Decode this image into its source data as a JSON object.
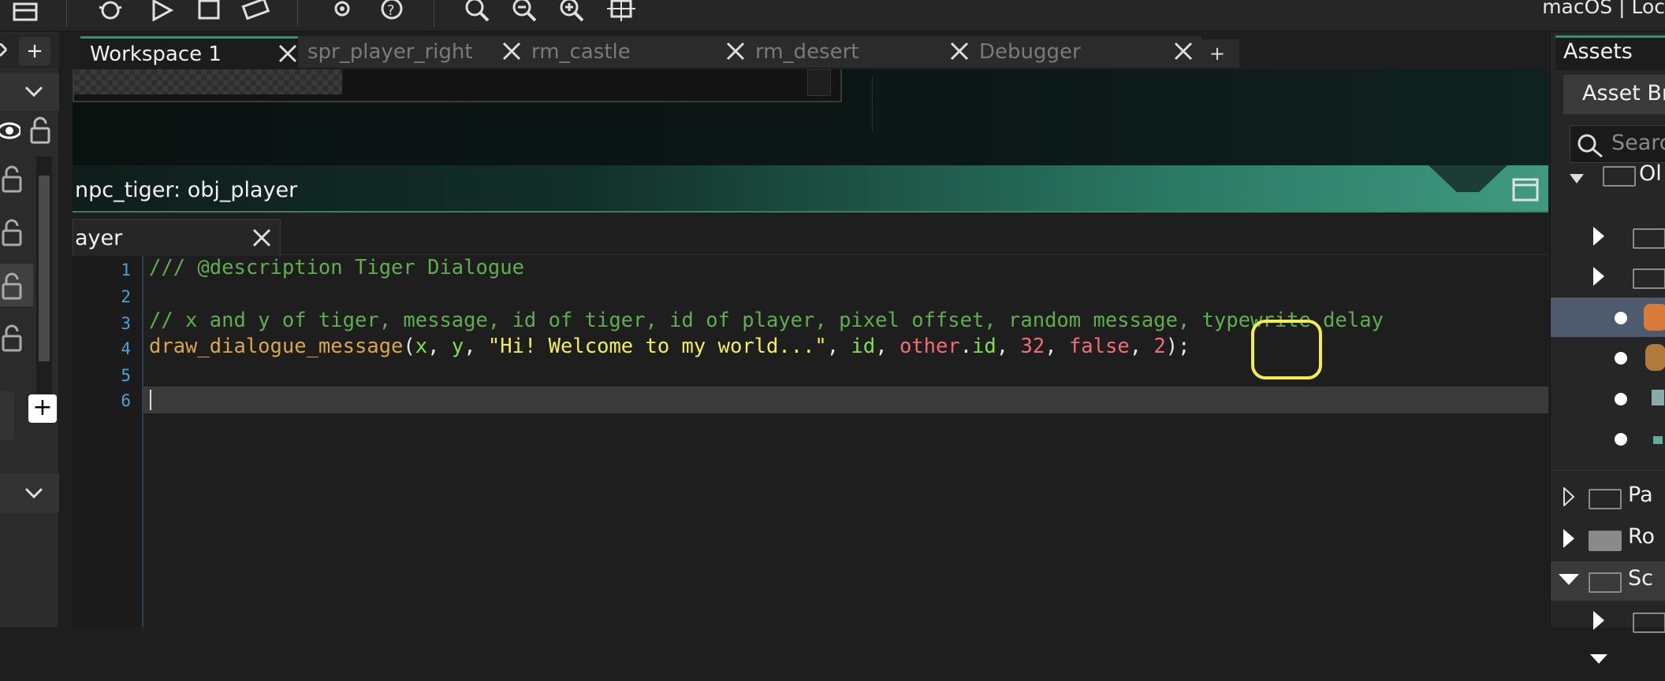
{
  "toolbar": {
    "os_label": "macOS | Loc"
  },
  "tabs": [
    {
      "label": "Workspace 1",
      "active": true
    },
    {
      "label": "spr_player_right",
      "active": false
    },
    {
      "label": "rm_castle",
      "active": false
    },
    {
      "label": "rm_desert",
      "active": false
    },
    {
      "label": "Debugger",
      "active": false
    }
  ],
  "tab_add_label": "+",
  "left_add_label": "+",
  "code_window": {
    "title": "npc_tiger: obj_player",
    "tab_label": "ayer"
  },
  "editor": {
    "line_numbers": [
      "1",
      "2",
      "3",
      "4",
      "5",
      "6"
    ],
    "lines": {
      "l1": "/// @description Tiger Dialogue",
      "l3": "// x and y of tiger, message, id of tiger, id of player, pixel offset, random message, typewrite delay",
      "l4_fn": "draw_dialogue_message",
      "l4_open": "(",
      "l4_x": "x",
      "l4_c1": ", ",
      "l4_y": "y",
      "l4_c2": ", ",
      "l4_str": "\"Hi! Welcome to my world...\"",
      "l4_c3": ", ",
      "l4_id": "id",
      "l4_c4": ", ",
      "l4_other": "other",
      "l4_dot": ".",
      "l4_oid": "id",
      "l4_c5": ", ",
      "l4_32": "32",
      "l4_c6": ", ",
      "l4_false": "false",
      "l4_c7": ", ",
      "l4_2": "2",
      "l4_end": ");"
    }
  },
  "assets": {
    "header": "Assets",
    "browser_button": "Asset Br",
    "search_placeholder": "Searc",
    "tree": {
      "partial_top": "Ol",
      "paths": "Pa",
      "rooms": "Ro",
      "scripts": "Sc"
    }
  },
  "colors": {
    "accent": "#3d8c6e",
    "highlight": "#f4ee4a",
    "line_number": "#4aa3d8"
  }
}
